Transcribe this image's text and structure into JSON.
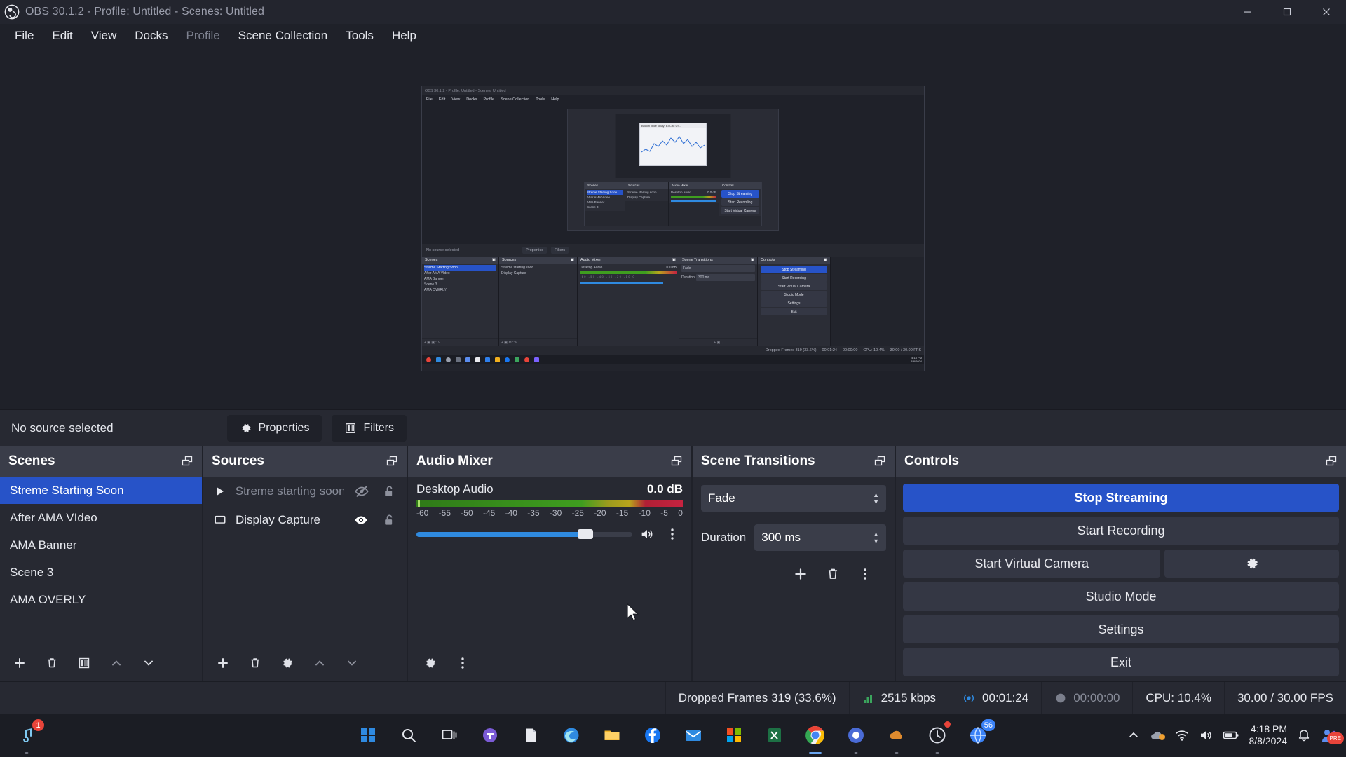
{
  "window": {
    "title": "OBS 30.1.2 - Profile: Untitled - Scenes: Untitled",
    "logo_icon": "obs-logo-icon",
    "minimize_label": "—",
    "maximize_label": "❐",
    "close_label": "✕"
  },
  "menubar": {
    "items": [
      {
        "label": "File",
        "dim": false
      },
      {
        "label": "Edit",
        "dim": false
      },
      {
        "label": "View",
        "dim": false
      },
      {
        "label": "Docks",
        "dim": false
      },
      {
        "label": "Profile",
        "dim": true
      },
      {
        "label": "Scene Collection",
        "dim": false
      },
      {
        "label": "Tools",
        "dim": false
      },
      {
        "label": "Help",
        "dim": false
      }
    ]
  },
  "preview": {
    "mini": {
      "title": "OBS 30.1.2 - Profile: Untitled - Scenes: Untitled",
      "menu": [
        "File",
        "Edit",
        "View",
        "Docks",
        "Profile",
        "Scene Collection",
        "Tools",
        "Help"
      ],
      "selected_label": "No source selected",
      "properties_label": "Properties",
      "filters_label": "Filters",
      "scenes_title": "Scenes",
      "scenes": [
        "Streme Starting Soon",
        "After AMA VIdeo",
        "AMA Banner",
        "Scene 3",
        "AMA OVERLY"
      ],
      "sources_title": "Sources",
      "sources": [
        "Streme starting soon",
        "Display Capture"
      ],
      "mixer_title": "Audio Mixer",
      "mixer_source": "Desktop Audio",
      "mixer_db": "0.0 dB",
      "transitions_title": "Scene Transitions",
      "transition_value": "Fade",
      "duration_label": "Duration",
      "duration_value": "300 ms",
      "controls_title": "Controls",
      "controls": [
        "Stop Streaming",
        "Start Recording",
        "Start Virtual Camera",
        "Studio Mode",
        "Settings",
        "Exit"
      ],
      "status_dropped": "Dropped Frames 319 (33.6%)",
      "status_time": "00:01:24",
      "status_rec": "00:00:00",
      "status_cpu": "CPU: 10.4%",
      "status_fps": "30.00 / 30.00 FPS",
      "chart_caption": "Bitcoin price today: BTC to US...",
      "tray_clock": "4:18 PM",
      "tray_date": "8/8/2024"
    }
  },
  "source_toolbar": {
    "selected_label": "No source selected",
    "properties_label": "Properties",
    "properties_icon": "gear-icon",
    "filters_label": "Filters",
    "filters_icon": "filters-icon"
  },
  "scenes_dock": {
    "title": "Scenes",
    "popout_icon": "popout-icon",
    "items": [
      {
        "label": "Streme Starting Soon",
        "selected": true
      },
      {
        "label": "After AMA VIdeo",
        "selected": false
      },
      {
        "label": "AMA Banner",
        "selected": false
      },
      {
        "label": "Scene 3",
        "selected": false
      },
      {
        "label": "AMA OVERLY",
        "selected": false
      }
    ],
    "toolbar": [
      {
        "icon": "add-icon",
        "label": "+"
      },
      {
        "icon": "remove-icon",
        "label": "🗑"
      },
      {
        "icon": "filters-icon",
        "label": ""
      },
      {
        "icon": "move-up-icon",
        "label": "∧"
      },
      {
        "icon": "move-down-icon",
        "label": "∨"
      }
    ]
  },
  "sources_dock": {
    "title": "Sources",
    "popout_icon": "popout-icon",
    "items": [
      {
        "label": "Streme starting soon",
        "type_icon": "media-source-icon",
        "visible": false,
        "locked": false
      },
      {
        "label": "Display Capture",
        "type_icon": "display-capture-icon",
        "visible": true,
        "locked": false
      }
    ],
    "toolbar": [
      {
        "icon": "add-icon"
      },
      {
        "icon": "remove-icon"
      },
      {
        "icon": "gear-icon"
      },
      {
        "icon": "move-up-icon"
      },
      {
        "icon": "move-down-icon"
      }
    ]
  },
  "mixer_dock": {
    "title": "Audio Mixer",
    "popout_icon": "popout-icon",
    "source_name": "Desktop Audio",
    "db_value": "0.0 dB",
    "ticks": [
      "-60",
      "-55",
      "-50",
      "-45",
      "-40",
      "-35",
      "-30",
      "-25",
      "-20",
      "-15",
      "-10",
      "-5",
      "0"
    ],
    "volume_percent": 80,
    "volume_icon": "speaker-icon",
    "menu_icon": "vertical-dots-icon",
    "settings_icon": "audio-settings-icon"
  },
  "transitions_dock": {
    "title": "Scene Transitions",
    "popout_icon": "popout-icon",
    "transition_value": "Fade",
    "duration_label": "Duration",
    "duration_value": "300 ms",
    "buttons": [
      {
        "icon": "add-icon"
      },
      {
        "icon": "remove-icon"
      },
      {
        "icon": "vertical-dots-icon"
      }
    ]
  },
  "controls_dock": {
    "title": "Controls",
    "popout_icon": "popout-icon",
    "stop_streaming": "Stop Streaming",
    "start_recording": "Start Recording",
    "start_virtual_camera": "Start Virtual Camera",
    "virtual_camera_settings_icon": "gear-icon",
    "studio_mode": "Studio Mode",
    "settings": "Settings",
    "exit": "Exit"
  },
  "statusbar": {
    "dropped_frames": "Dropped Frames 319 (33.6%)",
    "bitrate": "2515 kbps",
    "bitrate_icon": "signal-bars-icon",
    "stream_time": "00:01:24",
    "stream_icon": "broadcast-icon",
    "record_time": "00:00:00",
    "record_icon": "record-dot-icon",
    "cpu": "CPU: 10.4%",
    "fps": "30.00 / 30.00 FPS"
  },
  "taskbar": {
    "start_icon": "windows-start-icon",
    "search_icon": "search-icon",
    "taskview_icon": "task-view-icon",
    "apps": [
      {
        "name": "music-app-icon",
        "badge": "1"
      },
      {
        "name": "teams-icon",
        "badge": ""
      },
      {
        "name": "notepad-icon",
        "badge": ""
      },
      {
        "name": "edge-icon",
        "badge": ""
      },
      {
        "name": "file-explorer-icon",
        "badge": ""
      },
      {
        "name": "facebook-icon",
        "badge": ""
      },
      {
        "name": "mail-icon",
        "badge": ""
      },
      {
        "name": "store-icon",
        "badge": ""
      },
      {
        "name": "excel-icon",
        "badge": ""
      },
      {
        "name": "chrome-icon",
        "badge": ""
      },
      {
        "name": "obs-icon",
        "badge": ""
      },
      {
        "name": "cloud-app-icon",
        "badge": ""
      },
      {
        "name": "clock-app-icon",
        "badge": ""
      },
      {
        "name": "browser-app-icon",
        "badge": "56"
      }
    ],
    "tray": {
      "chevron_icon": "chevron-up-icon",
      "onedrive_icon": "onedrive-icon",
      "wifi_icon": "wifi-icon",
      "volume_icon": "volume-icon",
      "battery_icon": "battery-icon",
      "notification_icon": "bell-icon",
      "time": "4:18 PM",
      "date": "8/8/2024",
      "people_badge": "PRE"
    }
  },
  "colors": {
    "accent_blue": "#2753c8",
    "panel": "#272932",
    "panel_header": "#3a3d49",
    "background": "#1f2129",
    "text": "#e6e8ee"
  }
}
